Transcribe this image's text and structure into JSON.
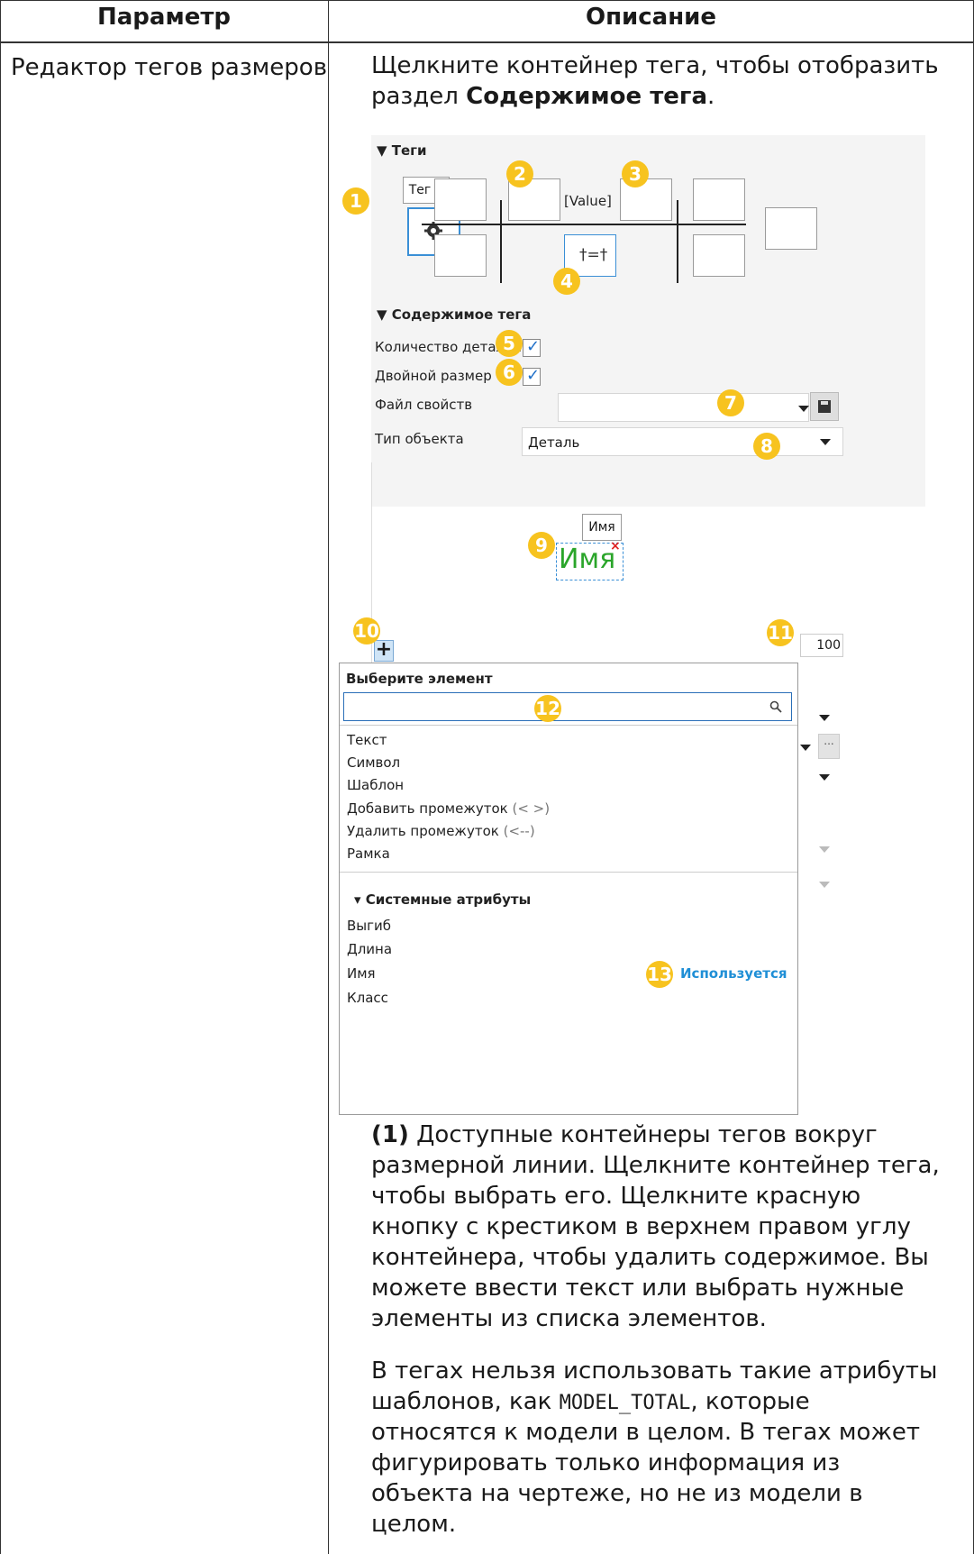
{
  "table": {
    "header_param": "Параметр",
    "header_desc": "Описание",
    "param_name": "Редактор тегов размеров"
  },
  "description": {
    "intro_line1": "Щелкните контейнер тега, чтобы отобразить",
    "intro_line2_prefix": "раздел ",
    "intro_line2_bold": "Содержимое тега",
    "intro_line2_suffix": ".",
    "para1_bold": "(1)",
    "para1_lines": [
      " Доступные контейнеры тегов вокруг",
      "размерной линии. Щелкните контейнер тега,",
      "чтобы выбрать его. Щелкните красную",
      "кнопку с крестиком в верхнем правом углу",
      "контейнера, чтобы удалить содержимое. Вы",
      "можете ввести текст или выбрать нужные",
      "элементы из списка элементов."
    ],
    "para2_line1": "В тегах нельзя использовать такие атрибуты",
    "para2_line2_prefix": "шаблонов, как ",
    "para2_code": "MODEL_TOTAL",
    "para2_line2_suffix": ", которые",
    "para2_lines_rest": [
      "относятся к модели в целом. В тегах может",
      "фигурировать только информация из",
      "объекта на чертеже, но не из модели в",
      "целом."
    ]
  },
  "screenshot": {
    "tags_section": "▼ Теги",
    "tag_b_label": "Тег B",
    "value_label": "[Value]",
    "content_section": "▼ Содержимое тега",
    "part_count_label": "Количество деталей",
    "double_dim_label": "Двойной размер",
    "props_file_label": "Файл свойств",
    "object_type_label": "Тип объекта",
    "object_type_value": "Деталь",
    "name_tag_label": "Имя",
    "name_preview": "Имя",
    "zoom_value": "100 %",
    "add_symbol": "+",
    "select_element_title": "Выберите элемент",
    "search_placeholder": "",
    "element_items": [
      "Текст",
      "Символ",
      "Шаблон"
    ],
    "add_space_label": "Добавить промежуток",
    "add_space_hint": "(< >)",
    "remove_space_label": "Удалить промежуток",
    "remove_space_hint": "(<--)",
    "frame_label": "Рамка",
    "system_attrs_section": "▾ Системные атрибуты",
    "system_attrs": [
      "Выгиб",
      "Длина",
      "Имя",
      "Класс"
    ],
    "used_label": "Используется",
    "badges": [
      "1",
      "2",
      "3",
      "4",
      "5",
      "6",
      "7",
      "8",
      "9",
      "10",
      "11",
      "12",
      "13"
    ],
    "colors": {
      "badge": "#f7c31f",
      "accent_blue": "#1f8fd6",
      "preview_green": "#2aa52a",
      "delete_red": "#e02020"
    }
  }
}
